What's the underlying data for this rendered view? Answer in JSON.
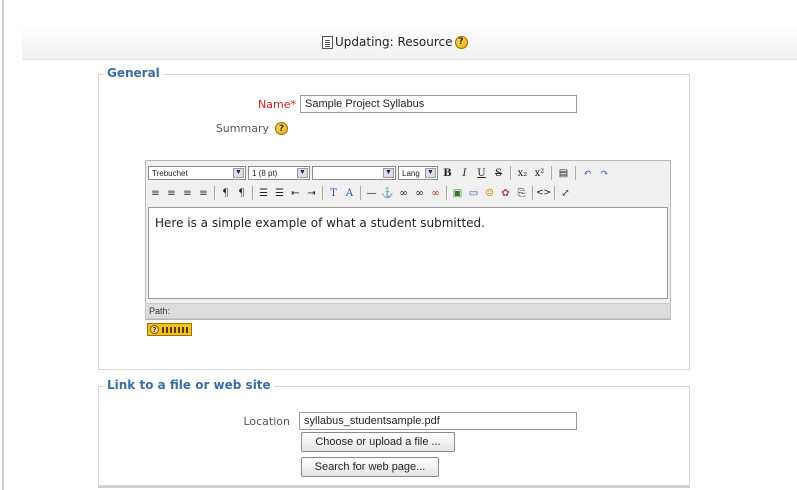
{
  "header": {
    "title": "Updating: Resource",
    "help": "?"
  },
  "general": {
    "legend": "General",
    "name_label": "Name",
    "required_mark": "*",
    "name_value": "Sample Project Syllabus",
    "summary_label": "Summary"
  },
  "editor": {
    "font": "Trebuchet",
    "size": "1 (8 pt)",
    "style": "",
    "lang": "Lang",
    "toolbar_row1": [
      "B",
      "I",
      "U",
      "S",
      "x₂",
      "x²",
      "▤",
      "↶",
      "↷"
    ],
    "toolbar_row2": [
      "≡",
      "≡",
      "≡",
      "≡",
      "¶",
      "¶",
      "☰",
      "☰",
      "⇤",
      "⇥",
      "T",
      "A",
      "—",
      "⚓",
      "∞",
      "∞",
      "∞",
      "▣",
      "▭",
      "☺",
      "✿",
      "⎘",
      "<>",
      "⤢"
    ],
    "content": "Here is a simple example of what a student submitted.",
    "path_label": "Path:"
  },
  "link": {
    "legend": "Link to a file or web site",
    "location_label": "Location",
    "location_value": "syllabus_studentsample.pdf",
    "choose_button": "Choose or upload a file ...",
    "search_button": "Search for web page..."
  },
  "colors": {
    "legend": "#3a6ea5",
    "required": "#cc2222",
    "help_icon": "#e0a000"
  }
}
